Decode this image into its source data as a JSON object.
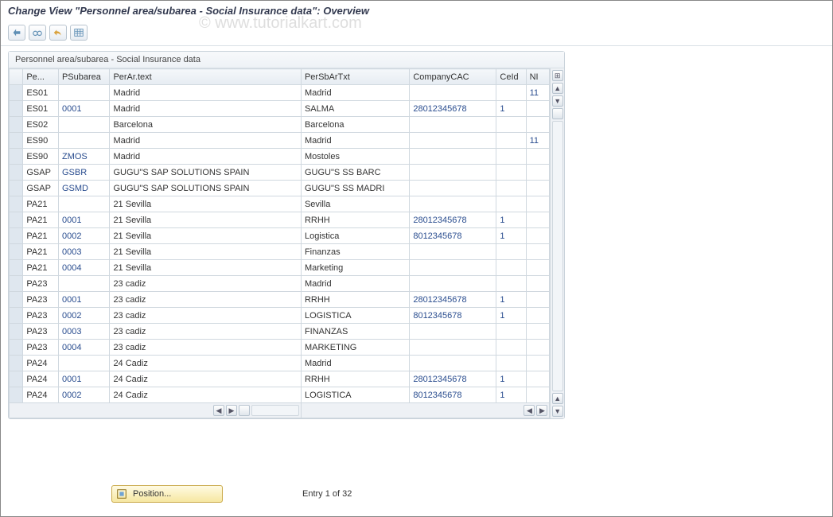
{
  "watermark": "© www.tutorialkart.com",
  "header": {
    "title": "Change View \"Personnel area/subarea - Social Insurance data\": Overview"
  },
  "toolbar": {
    "icons": [
      "expand-icon",
      "glasses-icon",
      "undo-icon",
      "table-icon"
    ]
  },
  "panel": {
    "title": "Personnel area/subarea - Social Insurance data"
  },
  "table": {
    "headers": {
      "pe": "Pe...",
      "psub": "PSubarea",
      "peratext": "PerAr.text",
      "persbartxt": "PerSbArTxt",
      "companycac": "CompanyCAC",
      "ceid": "CeId",
      "ni": "NI"
    },
    "rows": [
      {
        "pe": "ES01",
        "psub": "",
        "peratext": "Madrid",
        "persbartxt": "Madrid",
        "companycac": "",
        "ceid": "",
        "ni": "11"
      },
      {
        "pe": "ES01",
        "psub": "0001",
        "peratext": "Madrid",
        "persbartxt": "SALMA",
        "companycac": "28012345678",
        "ceid": "1",
        "ni": ""
      },
      {
        "pe": "ES02",
        "psub": "",
        "peratext": "Barcelona",
        "persbartxt": "Barcelona",
        "companycac": "",
        "ceid": "",
        "ni": ""
      },
      {
        "pe": "ES90",
        "psub": "",
        "peratext": "Madrid",
        "persbartxt": "Madrid",
        "companycac": "",
        "ceid": "",
        "ni": "11"
      },
      {
        "pe": "ES90",
        "psub": "ZMOS",
        "peratext": "Madrid",
        "persbartxt": "Mostoles",
        "companycac": "",
        "ceid": "",
        "ni": ""
      },
      {
        "pe": "GSAP",
        "psub": "GSBR",
        "peratext": "GUGU\"S SAP SOLUTIONS SPAIN",
        "persbartxt": "GUGU\"S SS BARC",
        "companycac": "",
        "ceid": "",
        "ni": ""
      },
      {
        "pe": "GSAP",
        "psub": "GSMD",
        "peratext": "GUGU\"S SAP SOLUTIONS SPAIN",
        "persbartxt": "GUGU\"S SS MADRI",
        "companycac": "",
        "ceid": "",
        "ni": ""
      },
      {
        "pe": "PA21",
        "psub": "",
        "peratext": "21 Sevilla",
        "persbartxt": "Sevilla",
        "companycac": "",
        "ceid": "",
        "ni": ""
      },
      {
        "pe": "PA21",
        "psub": "0001",
        "peratext": "21 Sevilla",
        "persbartxt": "RRHH",
        "companycac": "28012345678",
        "ceid": "1",
        "ni": ""
      },
      {
        "pe": "PA21",
        "psub": "0002",
        "peratext": "21 Sevilla",
        "persbartxt": "Logistica",
        "companycac": "8012345678",
        "ceid": "1",
        "ni": ""
      },
      {
        "pe": "PA21",
        "psub": "0003",
        "peratext": "21 Sevilla",
        "persbartxt": "Finanzas",
        "companycac": "",
        "ceid": "",
        "ni": ""
      },
      {
        "pe": "PA21",
        "psub": "0004",
        "peratext": "21 Sevilla",
        "persbartxt": "Marketing",
        "companycac": "",
        "ceid": "",
        "ni": ""
      },
      {
        "pe": "PA23",
        "psub": "",
        "peratext": "23 cadiz",
        "persbartxt": "Madrid",
        "companycac": "",
        "ceid": "",
        "ni": ""
      },
      {
        "pe": "PA23",
        "psub": "0001",
        "peratext": "23 cadiz",
        "persbartxt": "RRHH",
        "companycac": "28012345678",
        "ceid": "1",
        "ni": ""
      },
      {
        "pe": "PA23",
        "psub": "0002",
        "peratext": "23 cadiz",
        "persbartxt": "LOGISTICA",
        "companycac": "8012345678",
        "ceid": "1",
        "ni": ""
      },
      {
        "pe": "PA23",
        "psub": "0003",
        "peratext": "23 cadiz",
        "persbartxt": "FINANZAS",
        "companycac": "",
        "ceid": "",
        "ni": ""
      },
      {
        "pe": "PA23",
        "psub": "0004",
        "peratext": "23 cadiz",
        "persbartxt": "MARKETING",
        "companycac": "",
        "ceid": "",
        "ni": ""
      },
      {
        "pe": "PA24",
        "psub": "",
        "peratext": "24 Cadiz",
        "persbartxt": "Madrid",
        "companycac": "",
        "ceid": "",
        "ni": ""
      },
      {
        "pe": "PA24",
        "psub": "0001",
        "peratext": "24 Cadiz",
        "persbartxt": "RRHH",
        "companycac": "28012345678",
        "ceid": "1",
        "ni": ""
      },
      {
        "pe": "PA24",
        "psub": "0002",
        "peratext": "24 Cadiz",
        "persbartxt": "LOGISTICA",
        "companycac": "8012345678",
        "ceid": "1",
        "ni": ""
      }
    ]
  },
  "footer": {
    "position_label": "Position...",
    "entry_text": "Entry 1 of 32"
  },
  "scroll_icons": {
    "up": "▲",
    "down": "▼",
    "left": "◀",
    "right": "▶",
    "config": "⊞"
  }
}
